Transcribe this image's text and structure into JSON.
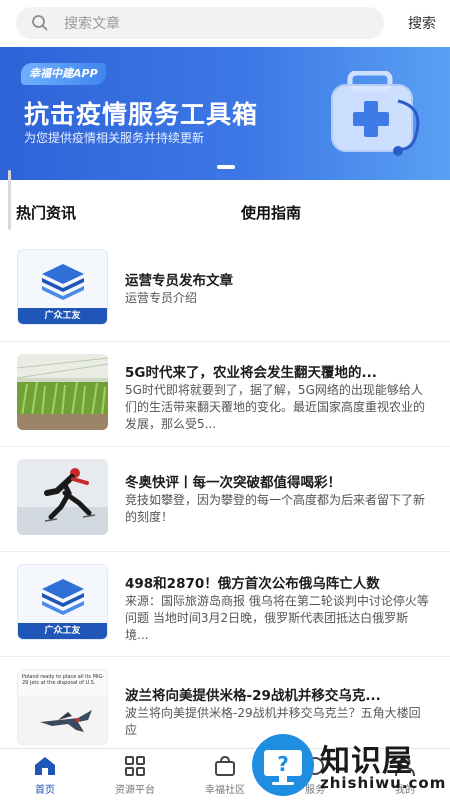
{
  "search": {
    "placeholder": "搜索文章",
    "action_label": "搜索"
  },
  "banner": {
    "tag": "幸福中建APP",
    "title": "抗击疫情服务工具箱",
    "subtitle": "为您提供疫情相关服务并持续更新"
  },
  "tabs": [
    {
      "label": "热门资讯"
    },
    {
      "label": "使用指南"
    }
  ],
  "news": [
    {
      "title": "运营专员发布文章",
      "desc": "运营专员介绍",
      "thumb_label": "广众工友"
    },
    {
      "title": "5G时代来了，农业将会发生翻天覆地的...",
      "desc": "5G时代即将就要到了，据了解，5G网络的出现能够给人们的生活带来翻天覆地的变化。最近国家高度重视农业的发展，那么受5..."
    },
    {
      "title": "冬奥快评丨每一次突破都值得喝彩！",
      "desc": "竞技如攀登，因为攀登的每一个高度都为后来者留下了新的刻度！"
    },
    {
      "title": "498和2870！俄方首次公布俄乌阵亡人数",
      "desc": "来源：国际旅游岛商报 俄乌将在第二轮谈判中讨论停火等问题 当地时间3月2日晚，俄罗斯代表团抵达白俄罗斯境...",
      "thumb_label": "广众工友"
    },
    {
      "title": "波兰将向美提供米格-29战机并移交乌克...",
      "desc": "波兰将向美提供米格-29战机并移交乌克兰？五角大楼回应",
      "thumb_caption": "Poland ready to place all its MiG-29 jets at the disposal of U.S."
    }
  ],
  "bottom_nav": [
    {
      "label": "首页",
      "icon": "home-icon",
      "active": true
    },
    {
      "label": "资源平台",
      "icon": "grid-icon"
    },
    {
      "label": "幸福社区",
      "icon": "bag-icon"
    },
    {
      "label": "服务",
      "icon": "service-icon"
    },
    {
      "label": "我的",
      "icon": "user-icon"
    }
  ],
  "watermark": {
    "text": "知识屋",
    "url": "zhishiwu.com"
  },
  "colors": {
    "primary": "#1f56b8",
    "banner_start": "#2e63d8",
    "banner_end": "#5aa0f3"
  }
}
